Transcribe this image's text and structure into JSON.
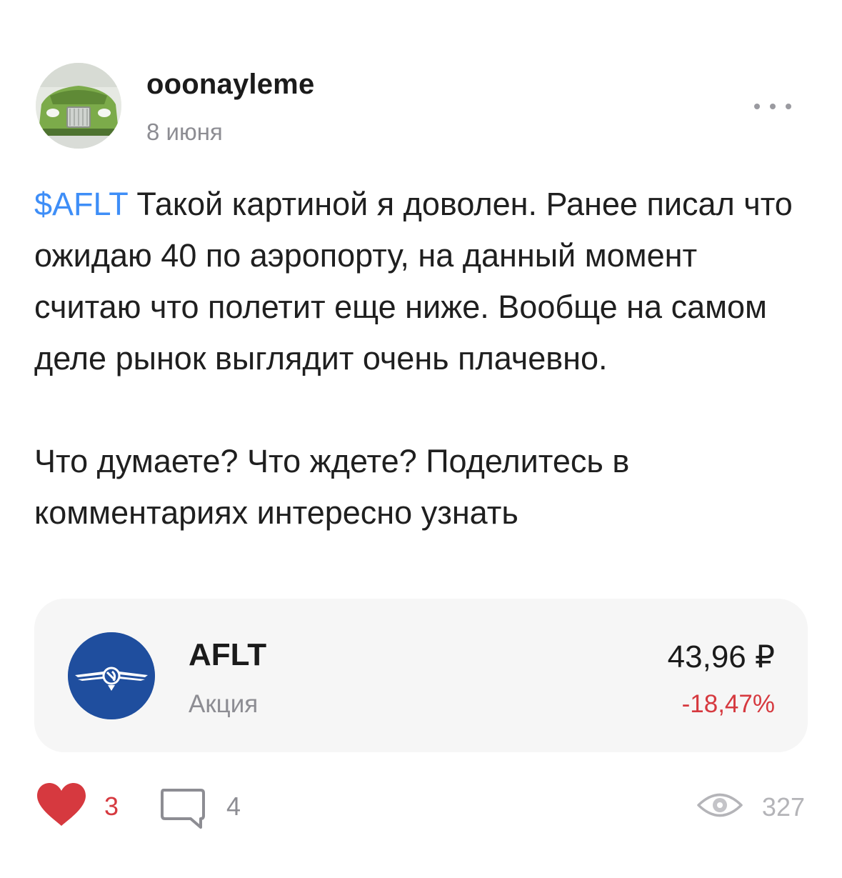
{
  "post": {
    "author": {
      "username": "ooonayleme",
      "date": "8 июня"
    },
    "body": {
      "ticker_tag": "$AFLT",
      "paragraph_1_rest": " Такой картиной я доволен. Ранее писал что ожидаю 40 по аэропорту, на данный момент считаю что полетит еще ниже. Вообще на самом деле рынок выглядит очень плачевно.",
      "paragraph_2": "Что думаете? Что ждете? Поделитесь в комментариях интересно узнать"
    }
  },
  "instrument": {
    "ticker": "AFLT",
    "type": "Акция",
    "price": "43,96 ₽",
    "change": "-18,47%",
    "logo_color": "#1f4e9e",
    "change_color": "#d6393f"
  },
  "footer": {
    "likes": "3",
    "comments": "4",
    "views": "327"
  },
  "icons": {
    "more": "more-dots-icon",
    "like": "heart-icon",
    "comments": "comment-icon",
    "views": "eye-icon"
  },
  "colors": {
    "accent_link": "#3e8ef7",
    "heart": "#d6393f",
    "muted_text": "#8d8d93"
  }
}
